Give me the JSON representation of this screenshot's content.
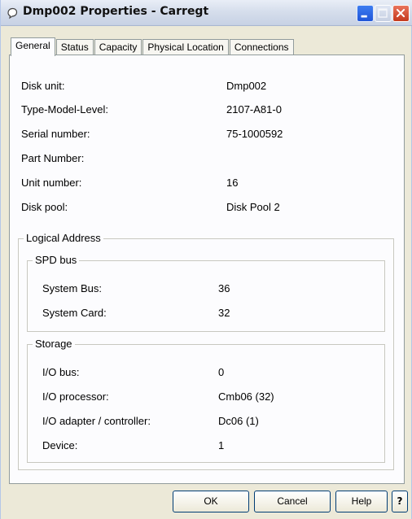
{
  "window": {
    "title": "Dmp002 Properties - Carregt"
  },
  "tabs": [
    {
      "label": "General"
    },
    {
      "label": "Status"
    },
    {
      "label": "Capacity"
    },
    {
      "label": "Physical Location"
    },
    {
      "label": "Connections"
    }
  ],
  "general": {
    "disk_unit": {
      "label": "Disk unit:",
      "value": "Dmp002"
    },
    "type_model_level": {
      "label": "Type-Model-Level:",
      "value": "2107-A81-0"
    },
    "serial_number": {
      "label": "Serial number:",
      "value": "75-1000592"
    },
    "part_number": {
      "label": "Part Number:",
      "value": ""
    },
    "unit_number": {
      "label": "Unit number:",
      "value": "16"
    },
    "disk_pool": {
      "label": "Disk pool:",
      "value": "Disk Pool  2"
    }
  },
  "logical_address": {
    "title": "Logical Address",
    "spd_bus": {
      "title": "SPD bus",
      "system_bus": {
        "label": "System Bus:",
        "value": "36"
      },
      "system_card": {
        "label": "System Card:",
        "value": "32"
      }
    },
    "storage": {
      "title": "Storage",
      "io_bus": {
        "label": "I/O bus:",
        "value": "0"
      },
      "io_processor": {
        "label": "I/O processor:",
        "value": "Cmb06 (32)"
      },
      "io_adapter": {
        "label": "I/O adapter / controller:",
        "value": "Dc06 (1)"
      },
      "device": {
        "label": "Device:",
        "value": "1"
      }
    }
  },
  "buttons": {
    "ok": "OK",
    "cancel": "Cancel",
    "help": "Help",
    "whats_this": "?"
  },
  "icons": {
    "title_icon": "disk-unit-icon",
    "minimize": "minimize-icon",
    "maximize": "maximize-icon",
    "close": "close-icon"
  }
}
